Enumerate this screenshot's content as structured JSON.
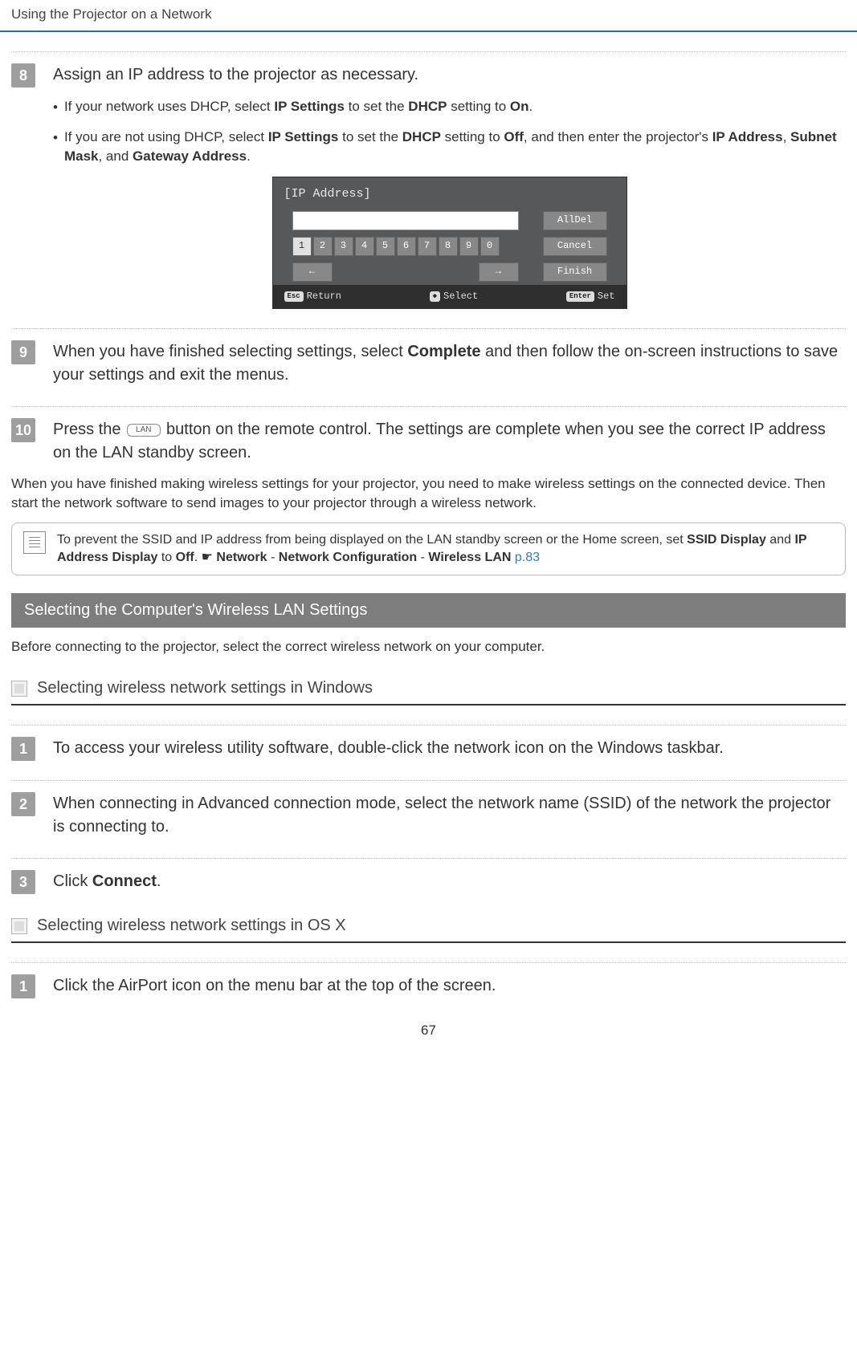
{
  "header": {
    "title": "Using the Projector on a Network"
  },
  "steps_a": {
    "s8": {
      "num": "8",
      "title": "Assign an IP address to the projector as necessary.",
      "b1_pre": "If your network uses DHCP, select ",
      "b1_bold1": "IP Settings",
      "b1_mid": " to set the ",
      "b1_bold2": "DHCP",
      "b1_mid2": " setting to ",
      "b1_bold3": "On",
      "b1_end": ".",
      "b2_pre": "If you are not using DHCP, select ",
      "b2_bold1": "IP Settings",
      "b2_mid": " to set the ",
      "b2_bold2": "DHCP",
      "b2_mid2": " setting to ",
      "b2_bold3": "Off",
      "b2_mid3": ", and then enter the projector's ",
      "b2_bold4": "IP Address",
      "b2_mid4": ", ",
      "b2_bold5": "Subnet Mask",
      "b2_mid5": ", and ",
      "b2_bold6": "Gateway Address",
      "b2_end": "."
    },
    "s9": {
      "num": "9",
      "text_pre": "When you have finished selecting settings, select ",
      "text_bold": "Complete",
      "text_post": " and then follow the on-screen instructions to save your settings and exit the menus."
    },
    "s10": {
      "num": "10",
      "text_pre": "Press the ",
      "lan_label": "LAN",
      "text_post": " button on the remote control. The settings are complete when you see the correct IP address on the LAN standby screen."
    }
  },
  "dialog": {
    "title": "[IP Address]",
    "keys": [
      "1",
      "2",
      "3",
      "4",
      "5",
      "6",
      "7",
      "8",
      "9",
      "0"
    ],
    "arrows_left": "←",
    "arrows_right": "→",
    "btn_alldel": "AllDel",
    "btn_cancel": "Cancel",
    "btn_finish": "Finish",
    "foot_return_key": "Esc",
    "foot_return": "Return",
    "foot_select_key": "◆",
    "foot_select": "Select",
    "foot_set_key": "Enter",
    "foot_set": "Set"
  },
  "para1": "When you have finished making wireless settings for your projector, you need to make wireless settings on the connected device. Then start the network software to send images to your projector through a wireless network.",
  "note": {
    "pre": "To prevent the SSID and IP address from being displayed on the LAN standby screen or the Home screen, set ",
    "b1": "SSID Display",
    "mid1": " and ",
    "b2": "IP Address Display",
    "mid2": " to ",
    "b3": "Off",
    "mid3": ". ",
    "nav1": "Network",
    "dash1": " - ",
    "nav2": "Network Configuration",
    "dash2": " - ",
    "nav3": "Wireless LAN",
    "link": "p.83"
  },
  "section_title": "Selecting the Computer's Wireless LAN Settings",
  "para2": "Before connecting to the projector, select the correct wireless network on your computer.",
  "sub1": "Selecting wireless network settings in Windows",
  "win_steps": {
    "s1": {
      "num": "1",
      "text": "To access your wireless utility software, double-click the network icon on the Windows taskbar."
    },
    "s2": {
      "num": "2",
      "text": "When connecting in Advanced connection mode, select the network name (SSID) of the network the projector is connecting to."
    },
    "s3": {
      "num": "3",
      "text_pre": "Click ",
      "text_bold": "Connect",
      "text_post": "."
    }
  },
  "sub2": "Selecting wireless network settings in OS X",
  "osx_steps": {
    "s1": {
      "num": "1",
      "text": "Click the AirPort icon on the menu bar at the top of the screen."
    }
  },
  "page_number": "67"
}
